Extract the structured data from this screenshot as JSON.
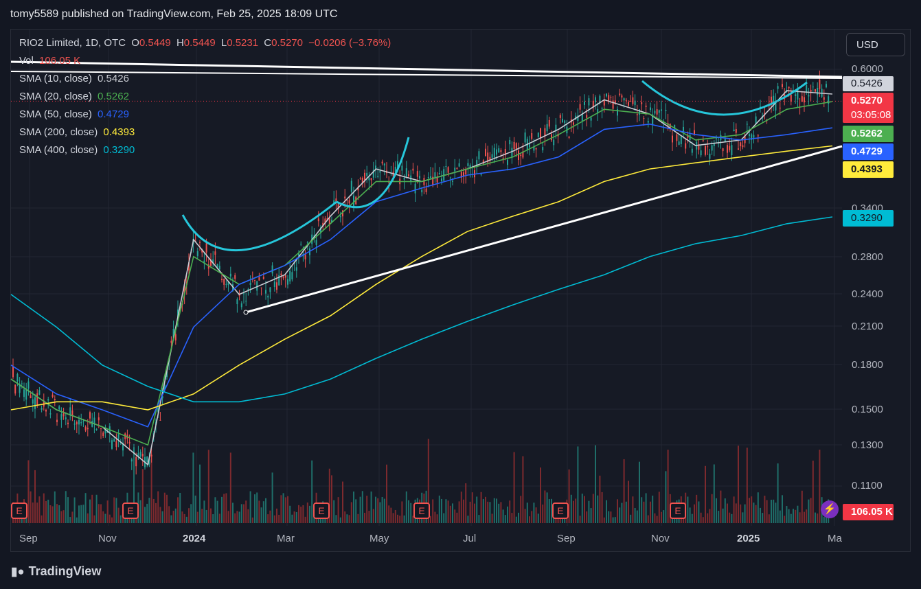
{
  "header": {
    "text": "tomy5589 published on TradingView.com, Feb 25, 2025 18:09 UTC"
  },
  "legend": {
    "symbol": "RIO2 Limited, 1D, OTC",
    "o_label": "O",
    "o_val": "0.5449",
    "h_label": "H",
    "h_val": "0.5449",
    "l_label": "L",
    "l_val": "0.5231",
    "c_label": "C",
    "c_val": "0.5270",
    "change": "−0.0206 (−3.76%)",
    "vol_label": "Vol",
    "vol_val": "106.05 K",
    "sma": [
      {
        "label": "SMA (10, close)",
        "value": "0.5426",
        "color": "#c9ccd3"
      },
      {
        "label": "SMA (20, close)",
        "value": "0.5262",
        "color": "#4caf50"
      },
      {
        "label": "SMA (50, close)",
        "value": "0.4729",
        "color": "#2962ff"
      },
      {
        "label": "SMA (200, close)",
        "value": "0.4393",
        "color": "#ffeb3b"
      },
      {
        "label": "SMA (400, close)",
        "value": "0.3290",
        "color": "#00bcd4"
      }
    ]
  },
  "currency_button": "USD",
  "price_labels": {
    "sma10": "0.5426",
    "last": "0.5270",
    "countdown": "03:05:08",
    "sma20": "0.5262",
    "sma50": "0.4729",
    "sma200": "0.4393",
    "sma400": "0.3290",
    "volume": "106.05 K"
  },
  "earnings_marker": "E",
  "footer": {
    "logo_text": "TradingView"
  },
  "colors": {
    "up": "#26a69a",
    "down": "#ef5350",
    "background": "#161a25",
    "text": "#d1d4dc"
  },
  "chart_data": {
    "type": "candlestick",
    "scale": "log",
    "ylim": [
      0.095,
      0.62
    ],
    "y_ticks": [
      "0.6000",
      "0.3400",
      "0.2800",
      "0.2400",
      "0.2100",
      "0.1800",
      "0.1500",
      "0.1300",
      "0.1100"
    ],
    "x_ticks": [
      "Sep",
      "Nov",
      "2024",
      "Mar",
      "May",
      "Jul",
      "Sep",
      "Nov",
      "2025",
      "Ma"
    ],
    "series": [
      {
        "name": "SMA (10, close)",
        "color": "#c9ccd3",
        "points": [
          [
            "Sep",
            0.17
          ],
          [
            "Oct",
            0.15
          ],
          [
            "Nov",
            0.14
          ],
          [
            "Dec",
            0.12
          ],
          [
            "2024",
            0.3
          ],
          [
            "Feb",
            0.24
          ],
          [
            "Mar",
            0.26
          ],
          [
            "Apr",
            0.33
          ],
          [
            "May",
            0.4
          ],
          [
            "Jun",
            0.38
          ],
          [
            "Jul",
            0.4
          ],
          [
            "Aug",
            0.43
          ],
          [
            "Sep",
            0.47
          ],
          [
            "Oct",
            0.53
          ],
          [
            "Nov",
            0.5
          ],
          [
            "Dec",
            0.44
          ],
          [
            "2025",
            0.45
          ],
          [
            "Feb",
            0.55
          ],
          [
            "Feb 25",
            0.5426
          ]
        ]
      },
      {
        "name": "SMA (20, close)",
        "color": "#4caf50",
        "points": [
          [
            "Sep",
            0.17
          ],
          [
            "Oct",
            0.15
          ],
          [
            "Nov",
            0.14
          ],
          [
            "Dec",
            0.13
          ],
          [
            "2024",
            0.28
          ],
          [
            "Feb",
            0.25
          ],
          [
            "Mar",
            0.27
          ],
          [
            "Apr",
            0.32
          ],
          [
            "May",
            0.38
          ],
          [
            "Jun",
            0.38
          ],
          [
            "Jul",
            0.4
          ],
          [
            "Aug",
            0.42
          ],
          [
            "Sep",
            0.46
          ],
          [
            "Oct",
            0.51
          ],
          [
            "Nov",
            0.5
          ],
          [
            "Dec",
            0.45
          ],
          [
            "2025",
            0.46
          ],
          [
            "Feb",
            0.51
          ],
          [
            "Feb 25",
            0.5262
          ]
        ]
      },
      {
        "name": "SMA (50, close)",
        "color": "#2962ff",
        "points": [
          [
            "Sep",
            0.18
          ],
          [
            "Oct",
            0.16
          ],
          [
            "Nov",
            0.15
          ],
          [
            "Dec",
            0.14
          ],
          [
            "2024",
            0.21
          ],
          [
            "Feb",
            0.25
          ],
          [
            "Mar",
            0.27
          ],
          [
            "Apr",
            0.3
          ],
          [
            "May",
            0.35
          ],
          [
            "Jun",
            0.37
          ],
          [
            "Jul",
            0.39
          ],
          [
            "Aug",
            0.4
          ],
          [
            "Sep",
            0.42
          ],
          [
            "Oct",
            0.47
          ],
          [
            "Nov",
            0.48
          ],
          [
            "Dec",
            0.46
          ],
          [
            "2025",
            0.45
          ],
          [
            "Feb",
            0.46
          ],
          [
            "Feb 25",
            0.4729
          ]
        ]
      },
      {
        "name": "SMA (200, close)",
        "color": "#ffeb3b",
        "points": [
          [
            "Sep",
            0.15
          ],
          [
            "Oct",
            0.155
          ],
          [
            "Nov",
            0.155
          ],
          [
            "Dec",
            0.15
          ],
          [
            "2024",
            0.16
          ],
          [
            "Feb",
            0.18
          ],
          [
            "Mar",
            0.2
          ],
          [
            "Apr",
            0.22
          ],
          [
            "May",
            0.25
          ],
          [
            "Jun",
            0.28
          ],
          [
            "Jul",
            0.31
          ],
          [
            "Aug",
            0.33
          ],
          [
            "Sep",
            0.35
          ],
          [
            "Oct",
            0.38
          ],
          [
            "Nov",
            0.4
          ],
          [
            "Dec",
            0.41
          ],
          [
            "2025",
            0.42
          ],
          [
            "Feb",
            0.43
          ],
          [
            "Feb 25",
            0.4393
          ]
        ]
      },
      {
        "name": "SMA (400, close)",
        "color": "#00bcd4",
        "points": [
          [
            "Sep",
            0.24
          ],
          [
            "Oct",
            0.21
          ],
          [
            "Nov",
            0.18
          ],
          [
            "Dec",
            0.165
          ],
          [
            "2024",
            0.155
          ],
          [
            "Feb",
            0.155
          ],
          [
            "Mar",
            0.16
          ],
          [
            "Apr",
            0.17
          ],
          [
            "May",
            0.185
          ],
          [
            "Jun",
            0.2
          ],
          [
            "Jul",
            0.215
          ],
          [
            "Aug",
            0.23
          ],
          [
            "Sep",
            0.245
          ],
          [
            "Oct",
            0.26
          ],
          [
            "Nov",
            0.28
          ],
          [
            "Dec",
            0.295
          ],
          [
            "2025",
            0.305
          ],
          [
            "Feb",
            0.32
          ],
          [
            "Feb 25",
            0.329
          ]
        ]
      }
    ],
    "last_close": 0.527
  }
}
